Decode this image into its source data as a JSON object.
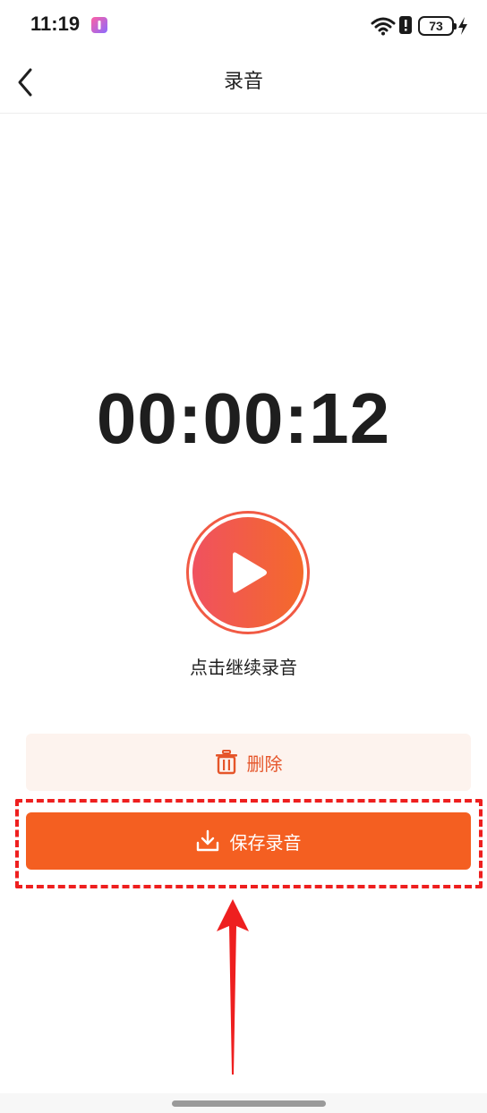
{
  "status_bar": {
    "time": "11:19",
    "battery": "73",
    "icons": [
      "app-notification-icon",
      "wifi-icon",
      "alert-icon",
      "battery-icon",
      "charging-icon"
    ]
  },
  "header": {
    "title": "录音",
    "back_icon": "chevron-left-icon"
  },
  "recorder": {
    "elapsed": "00:00:12",
    "play_icon": "play-icon",
    "hint": "点击继续录音"
  },
  "actions": {
    "delete_label": "删除",
    "delete_icon": "trash-icon",
    "save_label": "保存录音",
    "save_icon": "download-icon"
  },
  "colors": {
    "accent": "#f45f21",
    "delete_text": "#e5552a",
    "delete_bg": "#fdf3ee",
    "annotation": "#ee1f1f",
    "play_gradient": [
      "#f0515f",
      "#f46a2a"
    ]
  }
}
